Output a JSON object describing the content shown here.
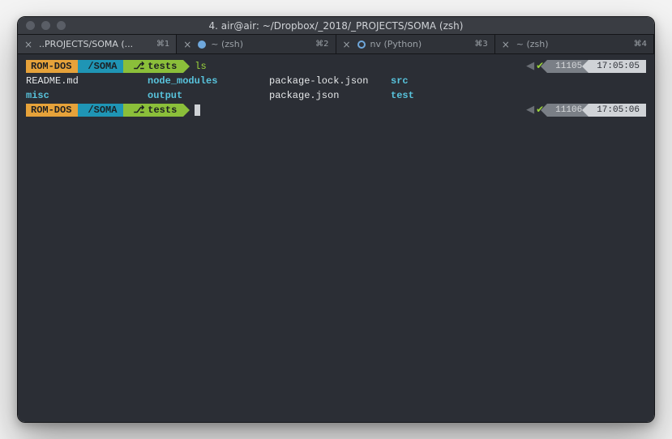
{
  "window": {
    "title": "4. air@air: ~/Dropbox/_2018/_PROJECTS/SOMA (zsh)"
  },
  "tabs": [
    {
      "label": "..PROJECTS/SOMA (...",
      "shortcut": "⌘1",
      "active": true,
      "icon": "none"
    },
    {
      "label": "~ (zsh)",
      "shortcut": "⌘2",
      "active": false,
      "icon": "dot"
    },
    {
      "label": "nv (Python)",
      "shortcut": "⌘3",
      "active": false,
      "icon": "ring"
    },
    {
      "label": "~ (zsh)",
      "shortcut": "⌘4",
      "active": false,
      "icon": "none"
    }
  ],
  "prompt": {
    "user": "ROM-DOS",
    "path": "/SOMA",
    "branch_icon": "⎇",
    "branch": "tests"
  },
  "lines": [
    {
      "type": "cmd",
      "command": "ls",
      "right": {
        "id": "11105",
        "time": "17:05:05"
      }
    },
    {
      "type": "ls",
      "cols": [
        {
          "text": "README.md",
          "color": "white"
        },
        {
          "text": "node_modules",
          "color": "cyan"
        },
        {
          "text": "package-lock.json",
          "color": "white"
        },
        {
          "text": "src",
          "color": "cyan"
        }
      ]
    },
    {
      "type": "ls",
      "cols": [
        {
          "text": "misc",
          "color": "cyan"
        },
        {
          "text": "output",
          "color": "cyan"
        },
        {
          "text": "package.json",
          "color": "white"
        },
        {
          "text": "test",
          "color": "cyan"
        }
      ]
    },
    {
      "type": "cmd",
      "command": "",
      "cursor": true,
      "right": {
        "id": "11106",
        "time": "17:05:06"
      }
    }
  ]
}
